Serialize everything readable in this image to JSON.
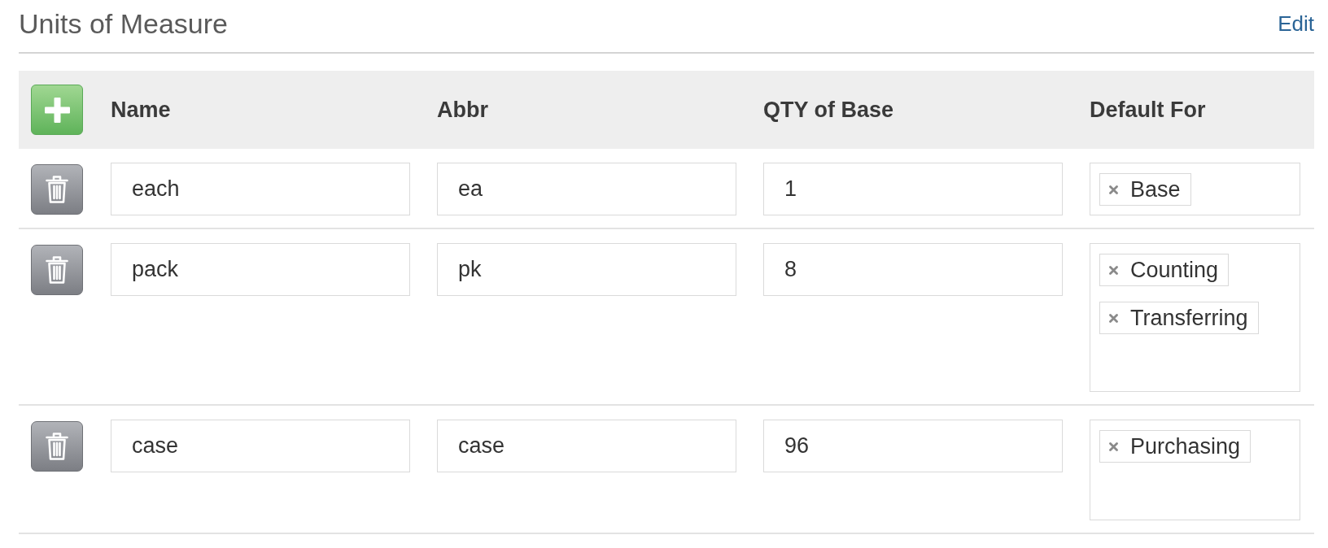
{
  "header": {
    "title": "Units of Measure",
    "edit_link": "Edit"
  },
  "table": {
    "columns": [
      "Name",
      "Abbr",
      "QTY of Base",
      "Default For"
    ],
    "rows": [
      {
        "name": "each",
        "abbr": "ea",
        "qty_of_base": "1",
        "default_for": [
          "Base"
        ]
      },
      {
        "name": "pack",
        "abbr": "pk",
        "qty_of_base": "8",
        "default_for": [
          "Counting",
          "Transferring"
        ]
      },
      {
        "name": "case",
        "abbr": "case",
        "qty_of_base": "96",
        "default_for": [
          "Purchasing"
        ]
      }
    ]
  }
}
